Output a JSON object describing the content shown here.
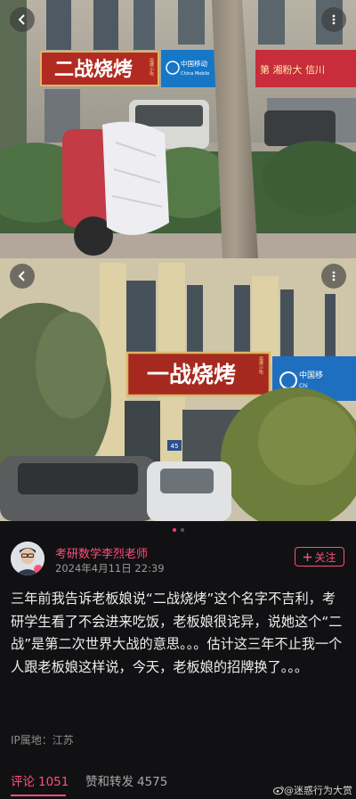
{
  "photos": {
    "first": {
      "shop_sign": "二战烧烤",
      "sign_small": "烧烤小吃",
      "bank_sign": "中国移动",
      "bank_sub": "China Mobile",
      "neighbor_sign": "第 湘粉大 信川"
    },
    "second": {
      "shop_sign": "一战烧烤",
      "sign_small": "烧烤小吃",
      "bank_sign": "中国移",
      "bank_sub": "Chi",
      "door_number": "45"
    }
  },
  "icons": {
    "back": "chevron-left-icon",
    "more": "more-vertical-icon",
    "follow": "plus-icon",
    "watermark": "weibo-icon"
  },
  "post": {
    "author": "考研数学李烈老师",
    "time": "2024年4月11日 22:39",
    "follow_label": "关注",
    "body": "三年前我告诉老板娘说“二战烧烤”这个名字不吉利，考研学生看了不会进来吃饭，老板娘很诧异，说她这个“二战”是第二次世界大战的意思。。。估计这三年不止我一个人跟老板娘这样说，今天，老板娘的招牌换了。。。",
    "ip": "IP属地：江苏"
  },
  "tabs": [
    {
      "label": "评论",
      "count": "1051",
      "active": true
    },
    {
      "label": "赞和转发",
      "count": "4575",
      "active": false
    }
  ],
  "watermark": "@迷惑行为大赏",
  "colors": {
    "accent": "#ff4f7b",
    "background": "#111113"
  }
}
